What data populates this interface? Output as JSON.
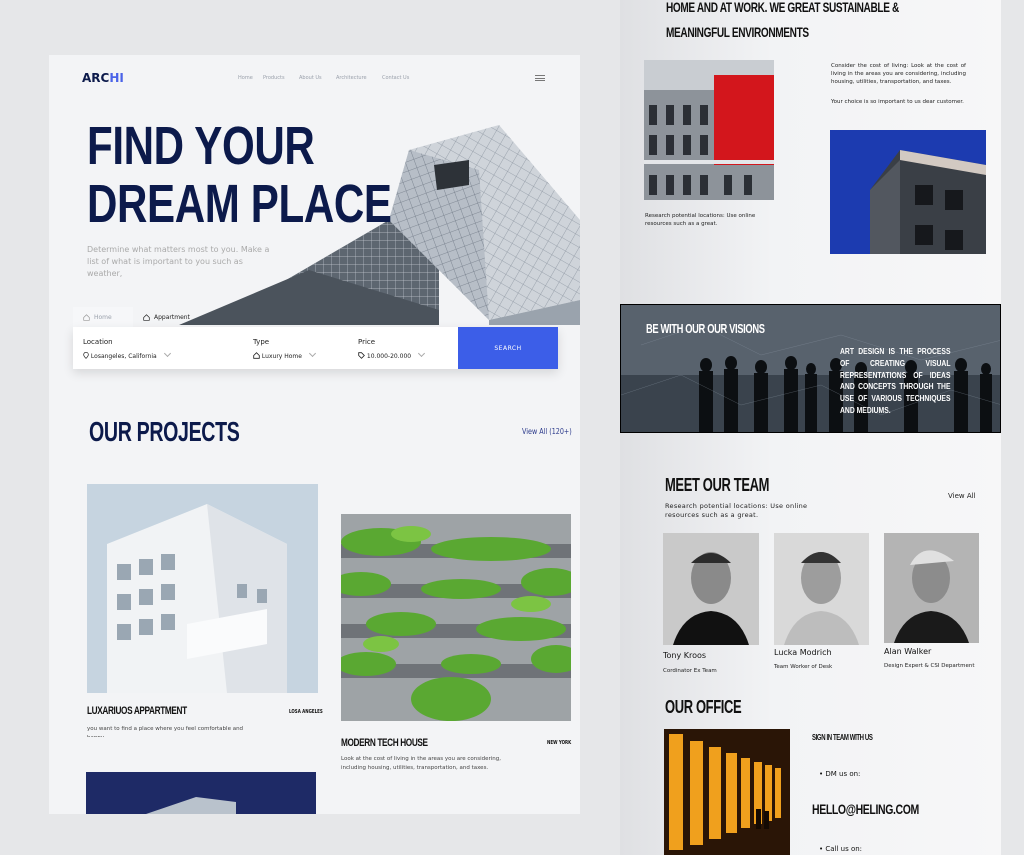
{
  "left": {
    "logo": {
      "main": "ARC",
      "accent": "HI"
    },
    "nav": [
      "Home",
      "Products",
      "About Us",
      "Architecture",
      "Contact Us"
    ],
    "hero": {
      "title_line1": "FIND YOUR",
      "title_line2": "DREAM PLACE",
      "description": "Determine what matters most to you. Make a list of what is important to you such as weather,"
    },
    "search": {
      "tabs": [
        "Home",
        "Appartment"
      ],
      "fields": [
        {
          "label": "Location",
          "value": "Losangeles, California"
        },
        {
          "label": "Type",
          "value": "Luxury Home"
        },
        {
          "label": "Price",
          "value": "10.000-20.000"
        }
      ],
      "button": "SEARCH"
    },
    "projects": {
      "title": "OUR PROJECTS",
      "view_all": "View All (120+)",
      "items": [
        {
          "title": "LUXARIUOS APPARTMENT",
          "location": "LOSA ANGELES",
          "description": "you want to find a place where you feel comfortable and happy"
        },
        {
          "title": "MODERN TECH HOUSE",
          "location": "NEW YORK",
          "description": "Look at the cost of living in the areas you are considering, including housing, utilities, transportation, and taxes."
        }
      ]
    }
  },
  "right": {
    "heading_line1": "HOME AND AT WORK. WE GREAT SUSTAINABLE &",
    "heading_line2": "MEANINGFUL ENVIRONMENTS",
    "text_right": "Consider the cost of living: Look at the cost of living in the areas you are considering, including housing, utilities, transportation, and taxes.",
    "text_right_2": "Your choice is so important to us dear customer.",
    "caption_left": "Research potential locations: Use online resources such as a great.",
    "vision": {
      "title": "BE WITH OUR OUR VISIONS",
      "text": "ART DESIGN IS THE PROCESS OF CREATING VISUAL REPRESENTATIONS OF IDEAS AND CONCEPTS THROUGH THE USE OF VARIOUS TECHNIQUES AND MEDIUMS."
    },
    "team": {
      "title": "MEET OUR TEAM",
      "view_all": "View All",
      "description": "Research potential locations: Use online resources such as a great.",
      "members": [
        {
          "name": "Tony Kroos",
          "role": "Cordinator Ex Team"
        },
        {
          "name": "Lucka Modrich",
          "role": "Team Worker of Desk"
        },
        {
          "name": "Alan Walker",
          "role": "Design Expert & CSI Department"
        }
      ]
    },
    "office": {
      "title": "OUR OFFICE",
      "signin": "SIGN IN TEAM WITH US",
      "dm_label": "DM us on:",
      "email": "HELLO@HELING.COM",
      "call_label": "Call us on:"
    }
  }
}
